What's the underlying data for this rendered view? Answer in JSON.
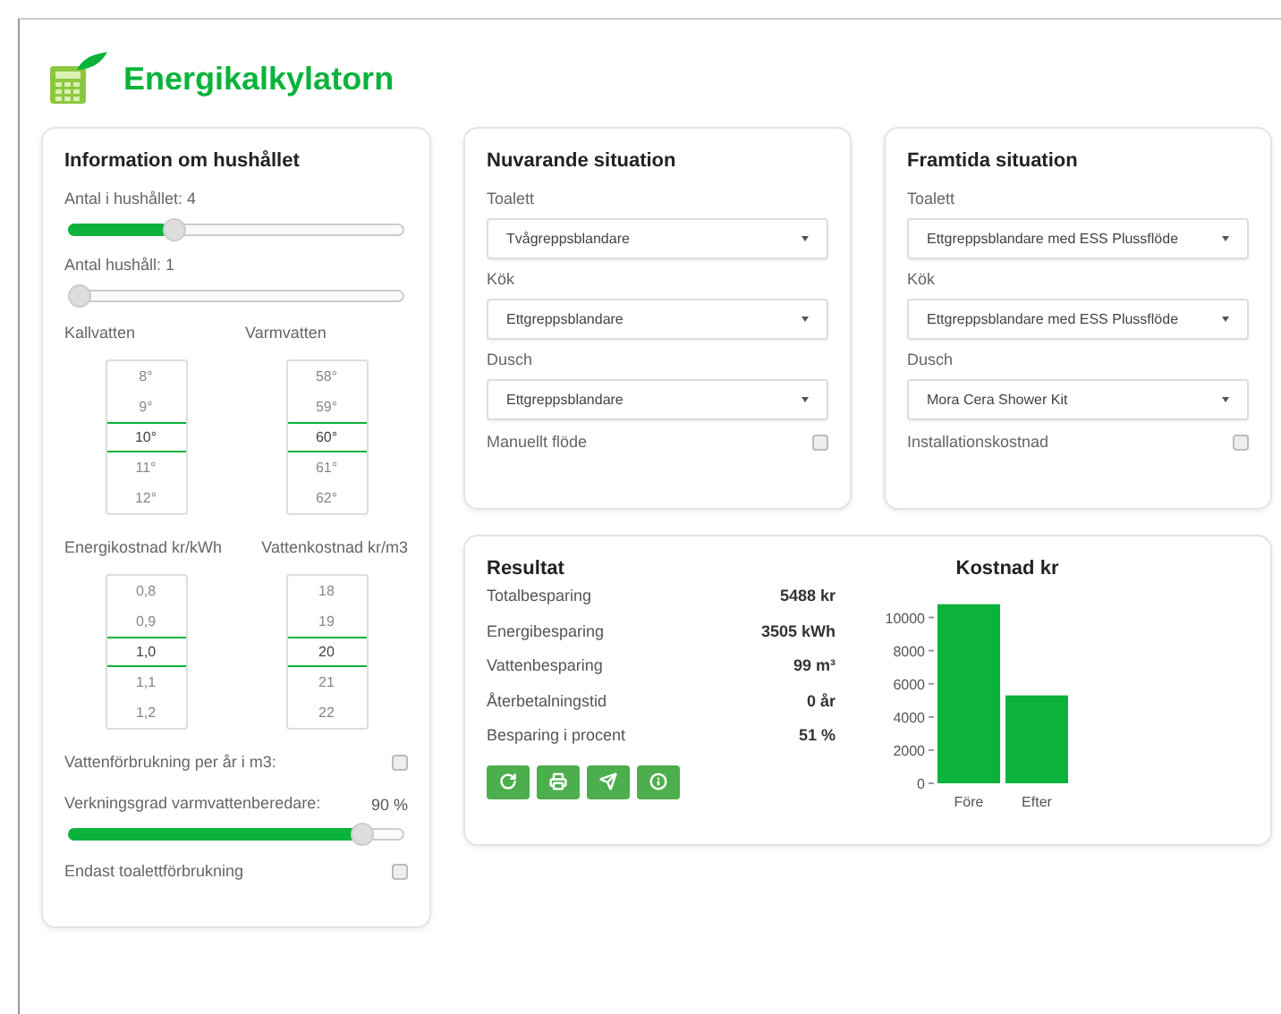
{
  "app": {
    "title": "Energikalkylatorn"
  },
  "household": {
    "title": "Information om hushållet",
    "sliders": [
      {
        "label": "Antal i hushållet: 4",
        "level": 0.3
      },
      {
        "label": "Antal hushåll: 1",
        "level": 0
      }
    ],
    "picker_groups": [
      {
        "labels": [
          "Kallvatten",
          "Varmvatten"
        ],
        "pickers": [
          {
            "values": [
              {
                "text": "8°",
                "selected": false
              },
              {
                "text": "9°",
                "selected": false
              },
              {
                "text": "10°",
                "selected": true
              },
              {
                "text": "11°",
                "selected": false
              },
              {
                "text": "12°",
                "selected": false
              }
            ]
          },
          {
            "values": [
              {
                "text": "58°",
                "selected": false
              },
              {
                "text": "59°",
                "selected": false
              },
              {
                "text": "60°",
                "selected": true
              },
              {
                "text": "61°",
                "selected": false
              },
              {
                "text": "62°",
                "selected": false
              }
            ]
          }
        ]
      },
      {
        "labels": [
          "Energikostnad kr/kWh",
          "Vattenkostnad kr/m3"
        ],
        "pickers": [
          {
            "values": [
              {
                "text": "0,8",
                "selected": false
              },
              {
                "text": "0,9",
                "selected": false
              },
              {
                "text": "1,0",
                "selected": true
              },
              {
                "text": "1,1",
                "selected": false
              },
              {
                "text": "1,2",
                "selected": false
              }
            ]
          },
          {
            "values": [
              {
                "text": "18",
                "selected": false
              },
              {
                "text": "19",
                "selected": false
              },
              {
                "text": "20",
                "selected": true
              },
              {
                "text": "21",
                "selected": false
              },
              {
                "text": "22",
                "selected": false
              }
            ]
          }
        ]
      }
    ],
    "water_use": {
      "label": "Vattenförbrukning per år i m3:",
      "checked": false
    },
    "efficiency": {
      "label": "Verkningsgrad varmvattenberedare:",
      "reading": "90 %",
      "level": 0.9
    },
    "toilet_only": {
      "label": "Endast toalettförbrukning",
      "checked": false
    }
  },
  "situations": [
    {
      "title": "Nuvarande situation",
      "fields": [
        {
          "label": "Toalett",
          "value": "Tvågreppsblandare"
        },
        {
          "label": "Kök",
          "value": "Ettgreppsblandare"
        },
        {
          "label": "Dusch",
          "value": "Ettgreppsblandare"
        }
      ],
      "option": {
        "label": "Manuellt flöde",
        "checked": false
      }
    },
    {
      "title": "Framtida situation",
      "fields": [
        {
          "label": "Toalett",
          "value": "Ettgreppsblandare med ESS Plussflöde"
        },
        {
          "label": "Kök",
          "value": "Ettgreppsblandare med ESS Plussflöde"
        },
        {
          "label": "Dusch",
          "value": "Mora Cera Shower Kit"
        }
      ],
      "option": {
        "label": "Installationskostnad",
        "checked": false
      }
    }
  ],
  "result": {
    "title": "Resultat",
    "rows": [
      {
        "label": "Totalbesparing",
        "value": "5488 kr"
      },
      {
        "label": "Energibesparing",
        "value": "3505 kWh"
      },
      {
        "label": "Vattenbesparing",
        "value": "99 m³"
      },
      {
        "label": "Återbetalningstid",
        "value": "0 år"
      },
      {
        "label": "Besparing i procent",
        "value": "51 %"
      }
    ],
    "buttons": [
      {
        "kind": "refresh"
      },
      {
        "kind": "print"
      },
      {
        "kind": "send"
      },
      {
        "kind": "info"
      }
    ],
    "chart_data": {
      "type": "bar",
      "title": "Kostnad kr",
      "categories": [
        "Före",
        "Efter"
      ],
      "series": [
        {
          "color": "#0bb33a",
          "values": [
            10800,
            5300
          ]
        }
      ],
      "ylim": [
        0,
        11000
      ],
      "yticks": [
        0,
        2000,
        4000,
        6000,
        8000,
        10000
      ]
    }
  }
}
